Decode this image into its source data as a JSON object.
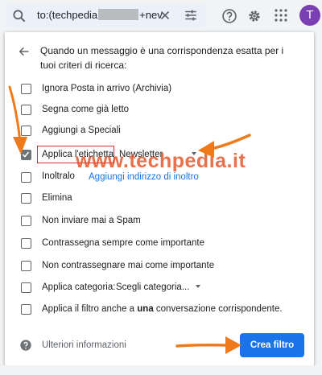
{
  "search": {
    "query_prefix": "to:(techpedia",
    "query_suffix": "+nev"
  },
  "header": {
    "avatar_letter": "T"
  },
  "dialog": {
    "title": "Quando un messaggio è una corrispondenza esatta per i tuoi criteri di ricerca:",
    "options": [
      {
        "label": "Ignora Posta in arrivo (Archivia)",
        "checked": false
      },
      {
        "label": "Segna come già letto",
        "checked": false
      },
      {
        "label": "Aggiungi a Speciali",
        "checked": false
      },
      {
        "label": "Applica l'etichetta",
        "checked": true
      },
      {
        "label": "Inoltralo",
        "checked": false
      },
      {
        "label": "Elimina",
        "checked": false
      },
      {
        "label": "Non inviare mai a Spam",
        "checked": false
      },
      {
        "label": "Contrassegna sempre come importante",
        "checked": false
      },
      {
        "label": "Non contrassegnare mai come importante",
        "checked": false
      },
      {
        "label": "Applica categoria:",
        "checked": false
      },
      {
        "label_pre": "Applica il filtro anche a ",
        "label_bold": "una",
        "label_post": " conversazione corrispondente.",
        "checked": false
      }
    ],
    "label_select_value": "Newsletter",
    "forward_link": "Aggiungi indirizzo di inoltro",
    "category_select_value": "Scegli categoria...",
    "more_info": "Ulteriori informazioni",
    "create_button": "Crea filtro"
  },
  "watermark": "www.techpedia.it",
  "colors": {
    "accent": "#1a73e8",
    "avatar": "#7b3fb4",
    "annotation_arrow": "#f07a1a",
    "highlight_box": "#d93025"
  }
}
